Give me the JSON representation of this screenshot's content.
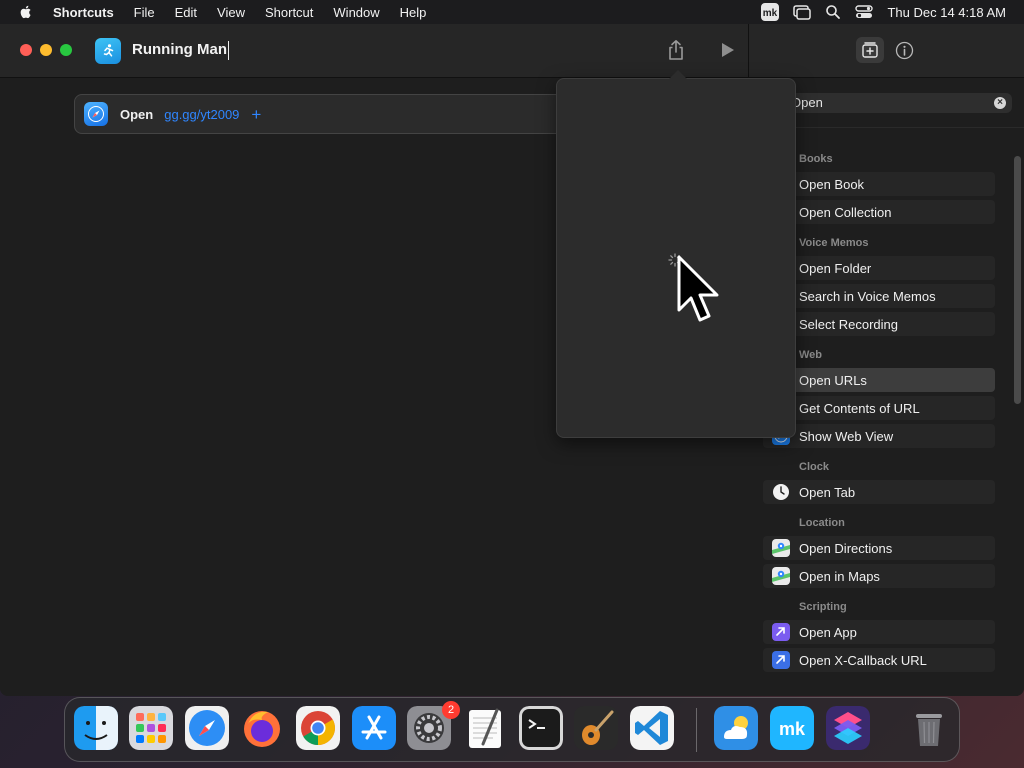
{
  "menubar": {
    "app_name": "Shortcuts",
    "items": [
      "File",
      "Edit",
      "View",
      "Shortcut",
      "Window",
      "Help"
    ],
    "clock": "Thu Dec 14  4:18 AM"
  },
  "window": {
    "shortcut_name": "Running Man"
  },
  "editor": {
    "action": {
      "verb": "Open",
      "url": "gg.gg/yt2009",
      "add": "+"
    }
  },
  "library": {
    "search_value": "Open",
    "sections": [
      {
        "title": "Books",
        "items": [
          {
            "label": "Open Book",
            "icon": "none"
          },
          {
            "label": "Open Collection",
            "icon": "none"
          }
        ]
      },
      {
        "title": "Voice Memos",
        "items": [
          {
            "label": "Open Folder",
            "icon": "none"
          },
          {
            "label": "Search in Voice Memos",
            "icon": "none"
          },
          {
            "label": "Select Recording",
            "icon": "none"
          }
        ]
      },
      {
        "title": "Web",
        "items": [
          {
            "label": "Open URLs",
            "icon": "none",
            "selected": true
          },
          {
            "label": "Get Contents of URL",
            "icon": "none"
          },
          {
            "label": "Show Web View",
            "icon": "safari-icon",
            "color": "#1a7ff0"
          }
        ]
      },
      {
        "title": "Clock",
        "items": [
          {
            "label": "Open Tab",
            "icon": "clock-icon",
            "color": "#f2f2f2"
          }
        ]
      },
      {
        "title": "Location",
        "items": [
          {
            "label": "Open Directions",
            "icon": "maps-icon",
            "color": "#5bc46a"
          },
          {
            "label": "Open in Maps",
            "icon": "maps-icon",
            "color": "#5bc46a"
          }
        ]
      },
      {
        "title": "Scripting",
        "items": [
          {
            "label": "Open App",
            "icon": "scripting-icon",
            "color": "#7b5cf0"
          },
          {
            "label": "Open X-Callback URL",
            "icon": "scripting-icon",
            "color": "#3b6fe6"
          }
        ]
      }
    ]
  },
  "dock": {
    "apps": [
      "Finder",
      "Launchpad",
      "Safari",
      "Firefox",
      "Chrome",
      "App Store",
      "System Settings",
      "TextEdit",
      "Terminal",
      "GarageBand",
      "Visual Studio Code",
      "Weather",
      "mk",
      "Shortcuts",
      "Trash"
    ],
    "settings_badge": "2"
  },
  "colors": {
    "accent": "#2f86ff",
    "close": "#ff5f57",
    "minimize": "#febc2e",
    "zoom": "#28c840",
    "badge": "#ff3b30"
  }
}
